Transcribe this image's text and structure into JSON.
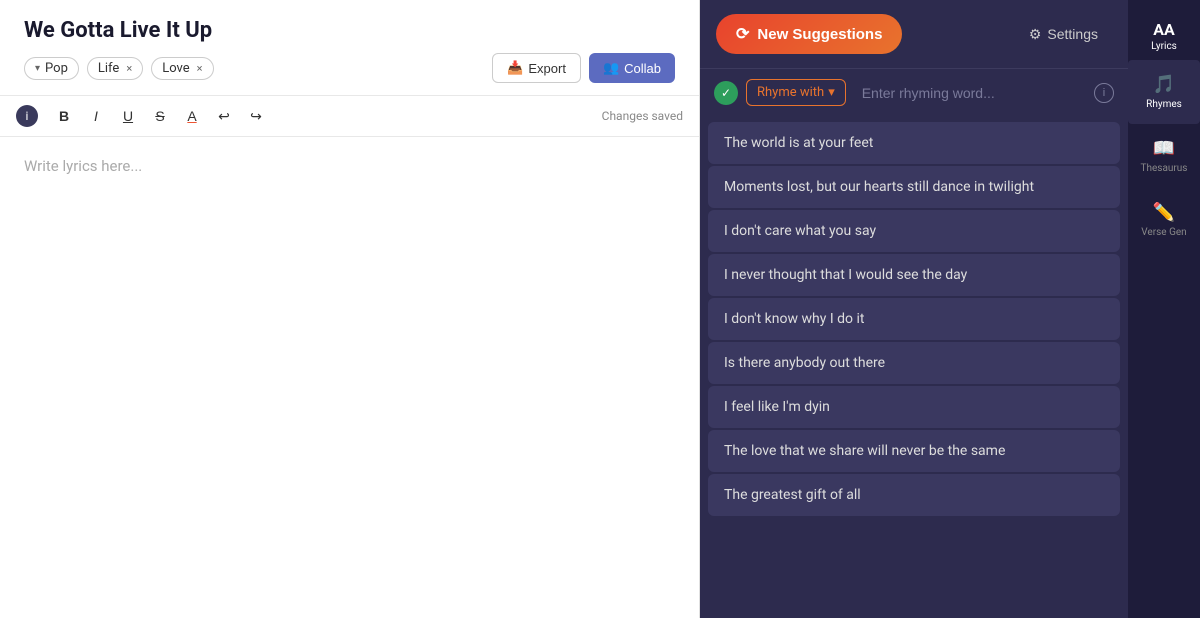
{
  "app": {
    "top_bar_height": 8
  },
  "left_panel": {
    "song_title": "We Gotta Live It Up",
    "tags": [
      {
        "label": "Pop",
        "type": "dropdown"
      },
      {
        "label": "Life",
        "type": "removable"
      },
      {
        "label": "Love",
        "type": "removable"
      }
    ],
    "export_button": "Export",
    "collab_button": "Collab",
    "toolbar": {
      "bold": "B",
      "italic": "I",
      "underline": "U",
      "strikethrough": "S",
      "text_color": "A",
      "undo": "↩",
      "redo": "↪",
      "status": "Changes saved"
    },
    "editor_placeholder": "Write lyrics here..."
  },
  "right_panel": {
    "new_suggestions_button": "✕ New Suggestions",
    "settings_button": "Settings",
    "rhyme_filter": {
      "select_label": "Rhyme with",
      "input_placeholder": "Enter rhyming word..."
    },
    "suggestions": [
      "The world is at your feet",
      "Moments lost, but our hearts still dance in twilight",
      "I don't care what you say",
      "I never thought that I would see the day",
      "I don't know why I do it",
      "Is there anybody out there",
      "I feel like I'm dyin",
      "The love that we share will never be the same",
      "The greatest gift of all"
    ]
  },
  "side_nav": {
    "lyrics": "Lyrics",
    "lyrics_aa": "AA",
    "items": [
      {
        "id": "rhymes",
        "label": "Rhymes",
        "icon": "♪"
      },
      {
        "id": "thesaurus",
        "label": "Thesaurus",
        "icon": "📖"
      },
      {
        "id": "verse-gen",
        "label": "Verse Gen",
        "icon": "✏️"
      }
    ]
  }
}
